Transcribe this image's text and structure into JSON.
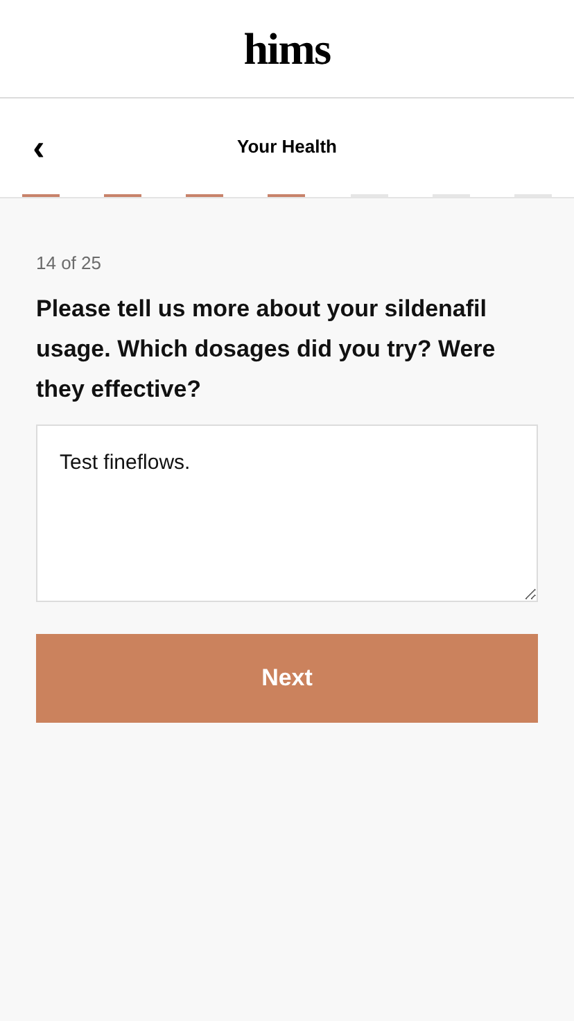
{
  "logo": "hims",
  "nav": {
    "back": "‹",
    "title": "Your Health"
  },
  "steps": [
    {
      "done": true
    },
    {
      "done": true
    },
    {
      "done": true
    },
    {
      "done": true
    },
    {
      "done": false
    },
    {
      "done": false
    },
    {
      "done": false
    }
  ],
  "counter": "14 of 25",
  "question": "Please tell us more about your sildenafil usage. Which dosages did you try? Were they effective?",
  "answer": {
    "value": "Test fineflows."
  },
  "next_button": "Next"
}
